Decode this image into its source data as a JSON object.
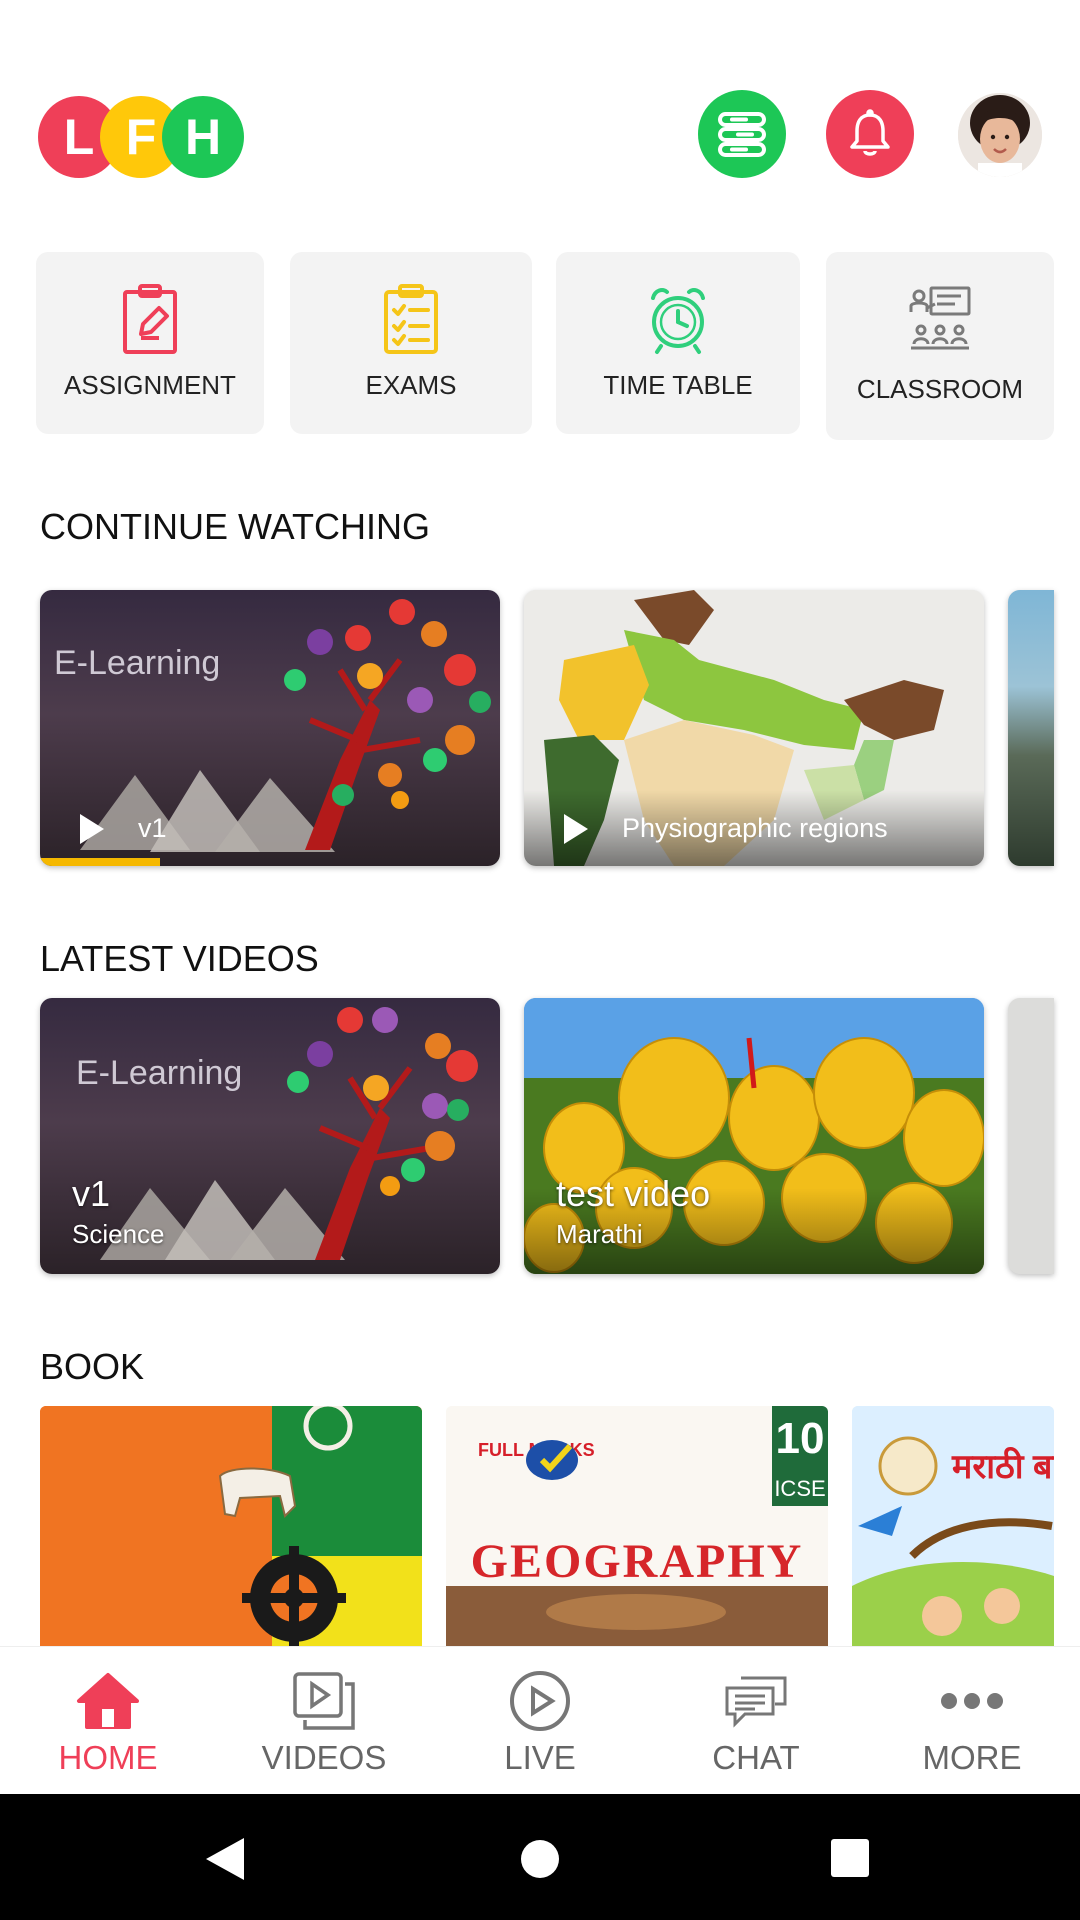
{
  "header": {
    "logo_letters": [
      "L",
      "F",
      "H"
    ],
    "logo_colors": [
      "#ef3f58",
      "#ffc80a",
      "#1dc756"
    ],
    "menu_icon": "stack-icon",
    "bell_icon": "bell-icon",
    "accent_green": "#1dc756",
    "accent_red": "#ef3f58"
  },
  "quick_actions": [
    {
      "label": "ASSIGNMENT",
      "icon": "assignment-icon",
      "color": "#ef3f58"
    },
    {
      "label": "EXAMS",
      "icon": "clipboard-checklist-icon",
      "color": "#f5c518"
    },
    {
      "label": "TIME TABLE",
      "icon": "alarm-clock-icon",
      "color": "#2fcf7c"
    },
    {
      "label": "CLASSROOM",
      "icon": "classroom-icon",
      "color": "#777777"
    }
  ],
  "continue_watching": {
    "title": "CONTINUE WATCHING",
    "items": [
      {
        "title": "v1",
        "progress": 0.26,
        "thumb_text": "E-Learning"
      },
      {
        "title": "Physiographic regions",
        "progress": 0
      }
    ]
  },
  "latest_videos": {
    "title": "LATEST VIDEOS",
    "items": [
      {
        "title": "v1",
        "subject": "Science",
        "thumb_text": "E-Learning"
      },
      {
        "title": "test video",
        "subject": "Marathi"
      }
    ]
  },
  "books": {
    "title": "BOOK",
    "items": [
      {
        "cover_text": ""
      },
      {
        "cover_text": "GEOGRAPHY",
        "badge_num": "10",
        "badge_sub": "ICSE",
        "brand": "FULL MARKS"
      },
      {
        "cover_text": "मराठी बालभा"
      }
    ]
  },
  "bottom_nav": [
    {
      "label": "HOME",
      "icon": "home-icon",
      "active": true
    },
    {
      "label": "VIDEOS",
      "icon": "videos-icon",
      "active": false
    },
    {
      "label": "LIVE",
      "icon": "play-circle-icon",
      "active": false
    },
    {
      "label": "CHAT",
      "icon": "chat-icon",
      "active": false
    },
    {
      "label": "MORE",
      "icon": "more-dots-icon",
      "active": false
    }
  ],
  "system_nav": {
    "back_icon": "back-triangle-icon",
    "home_icon": "home-circle-icon",
    "recents_icon": "recents-square-icon"
  }
}
